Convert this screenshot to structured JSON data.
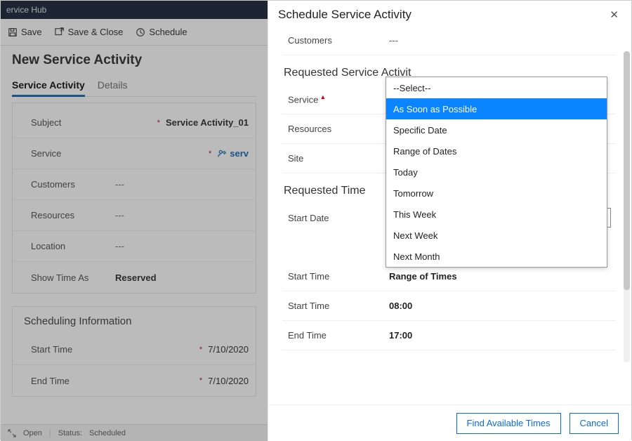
{
  "app": {
    "title": "ervice Hub"
  },
  "commands": {
    "save": "Save",
    "saveClose": "Save & Close",
    "schedule": "Schedule"
  },
  "page": {
    "title": "New Service Activity",
    "tabs": {
      "activity": "Service Activity",
      "details": "Details"
    }
  },
  "form": {
    "subject_label": "Subject",
    "subject_value": "Service Activity_01",
    "service_label": "Service",
    "service_value": "serv",
    "customers_label": "Customers",
    "customers_value": "---",
    "resources_label": "Resources",
    "resources_value": "---",
    "location_label": "Location",
    "location_value": "---",
    "showtime_label": "Show Time As",
    "showtime_value": "Reserved"
  },
  "sched_section": {
    "title": "Scheduling Information",
    "start_label": "Start Time",
    "start_value": "7/10/2020",
    "end_label": "End Time",
    "end_value": "7/10/2020"
  },
  "status": {
    "open": "Open",
    "status_label": "Status:",
    "status_value": "Scheduled"
  },
  "flyout": {
    "title": "Schedule Service Activity",
    "customers_label": "Customers",
    "customers_value": "---",
    "section_requested": "Requested Service Activit",
    "service_label": "Service",
    "resources_label": "Resources",
    "site_label": "Site",
    "section_time": "Requested Time",
    "startdate_label": "Start Date",
    "startdate_value": "As Soon as Possible",
    "starttime1_label": "Start Time",
    "starttime1_value": "Range of Times",
    "starttime2_label": "Start Time",
    "starttime2_value": "08:00",
    "endtime_label": "End Time",
    "endtime_value": "17:00"
  },
  "dropdown": {
    "options": {
      "o0": "--Select--",
      "o1": "As Soon as Possible",
      "o2": "Specific Date",
      "o3": "Range of Dates",
      "o4": "Today",
      "o5": "Tomorrow",
      "o6": "This Week",
      "o7": "Next Week",
      "o8": "Next Month"
    }
  },
  "buttons": {
    "find": "Find Available Times",
    "cancel": "Cancel"
  }
}
